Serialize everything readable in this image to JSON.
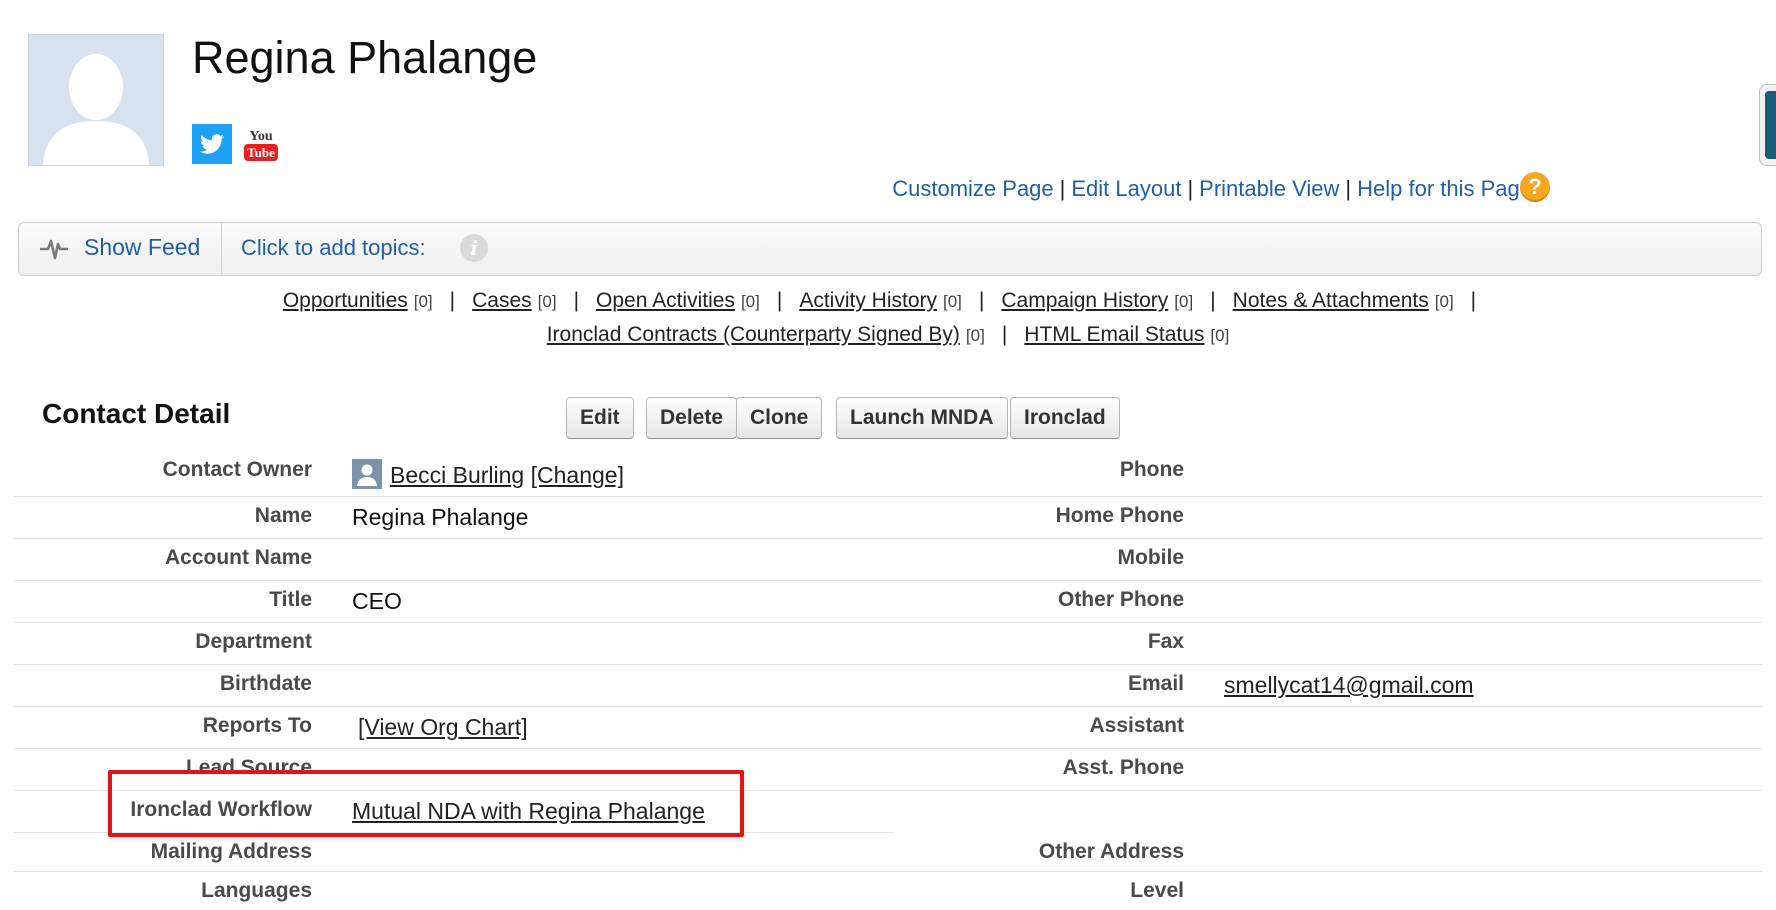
{
  "contact": {
    "name": "Regina Phalange"
  },
  "social": {
    "twitter_icon": "twitter-icon",
    "youtube_icon": "youtube-icon",
    "youtube_text_top": "You",
    "youtube_text_bottom": "Tube"
  },
  "top_links": {
    "customize": "Customize Page",
    "edit_layout": "Edit Layout",
    "printable": "Printable View",
    "help": "Help for this Page",
    "separator": "|",
    "help_icon_glyph": "?"
  },
  "feed_bar": {
    "show_feed": "Show Feed",
    "add_topics": "Click to add topics:",
    "info_glyph": "i"
  },
  "related_lists": {
    "row1": [
      {
        "label": "Opportunities",
        "count": "[0]"
      },
      {
        "label": "Cases",
        "count": "[0]"
      },
      {
        "label": "Open Activities",
        "count": "[0]"
      },
      {
        "label": "Activity History",
        "count": "[0]"
      },
      {
        "label": "Campaign History",
        "count": "[0]"
      },
      {
        "label": "Notes & Attachments",
        "count": "[0]"
      }
    ],
    "row2": [
      {
        "label": "Ironclad Contracts (Counterparty Signed By)",
        "count": "[0]"
      },
      {
        "label": "HTML Email Status",
        "count": "[0]"
      }
    ],
    "separator": "|"
  },
  "detail": {
    "title": "Contact Detail",
    "buttons": [
      "Edit",
      "Delete",
      "Clone",
      "Launch MNDA",
      "Ironclad"
    ],
    "left_labels": [
      "Contact Owner",
      "Name",
      "Account Name",
      "Title",
      "Department",
      "Birthdate",
      "Reports To",
      "Lead Source",
      "Ironclad Workflow",
      "Mailing Address",
      "Languages"
    ],
    "right_labels": [
      "Phone",
      "Home Phone",
      "Mobile",
      "Other Phone",
      "Fax",
      "Email",
      "Assistant",
      "Asst. Phone",
      "Other Address",
      "Level"
    ],
    "values": {
      "owner": "Becci Burling",
      "owner_change": "[Change]",
      "name": "Regina Phalange",
      "title": "CEO",
      "email": "smellycat14@gmail.com",
      "org_chart": "[View Org Chart]",
      "workflow": "Mutual NDA with Regina Phalange"
    }
  },
  "colors": {
    "link_blue": "#1f5fa7",
    "highlight_red": "#e01414",
    "help_orange": "#f5a623",
    "twitter_blue": "#1da1f2",
    "youtube_red": "#e5201f"
  }
}
